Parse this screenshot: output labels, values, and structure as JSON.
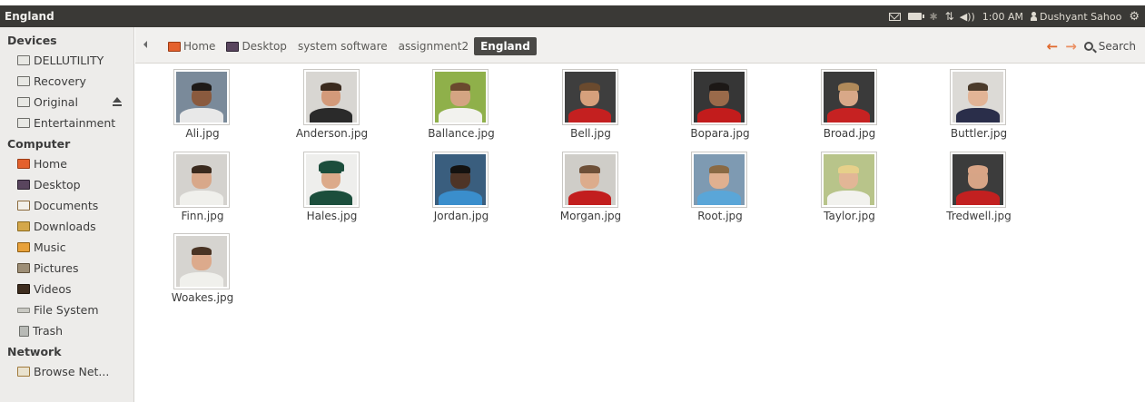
{
  "window": {
    "title": "England"
  },
  "top_panel": {
    "time": "1:00 AM",
    "user": "Dushyant Sahoo"
  },
  "sidebar": {
    "sections": [
      {
        "heading": "Devices",
        "items": [
          {
            "label": "DELLUTILITY",
            "icon": "drive"
          },
          {
            "label": "Recovery",
            "icon": "drive"
          },
          {
            "label": "Original",
            "icon": "drive",
            "eject": true
          },
          {
            "label": "Entertainment",
            "icon": "drive"
          }
        ]
      },
      {
        "heading": "Computer",
        "items": [
          {
            "label": "Home",
            "icon": "home"
          },
          {
            "label": "Desktop",
            "icon": "desktop"
          },
          {
            "label": "Documents",
            "icon": "documents"
          },
          {
            "label": "Downloads",
            "icon": "downloads"
          },
          {
            "label": "Music",
            "icon": "music"
          },
          {
            "label": "Pictures",
            "icon": "pictures"
          },
          {
            "label": "Videos",
            "icon": "videos"
          },
          {
            "label": "File System",
            "icon": "filesystem"
          },
          {
            "label": "Trash",
            "icon": "trash"
          }
        ]
      },
      {
        "heading": "Network",
        "items": [
          {
            "label": "Browse Net...",
            "icon": "network"
          }
        ]
      }
    ]
  },
  "breadcrumbs": [
    {
      "label": "Home",
      "icon": "home"
    },
    {
      "label": "Desktop",
      "icon": "desktop"
    },
    {
      "label": "system software"
    },
    {
      "label": "assignment2"
    },
    {
      "label": "England",
      "active": true
    }
  ],
  "toolbar": {
    "search_label": "Search"
  },
  "files": [
    {
      "name": "Ali.jpg",
      "bg": "#7a8a9a",
      "skin": "#8a5a3e",
      "shirt": "#e8e8e8",
      "hair": "#1e1a18"
    },
    {
      "name": "Anderson.jpg",
      "bg": "#d8d6d2",
      "skin": "#d39a7a",
      "shirt": "#2a2a2a",
      "hair": "#3a2a1e"
    },
    {
      "name": "Ballance.jpg",
      "bg": "#8fb04a",
      "skin": "#d4a482",
      "shirt": "#f2f2ee",
      "hair": "#6a4a2e"
    },
    {
      "name": "Bell.jpg",
      "bg": "#3e3e3e",
      "skin": "#d6a07c",
      "shirt": "#c42020",
      "hair": "#6a4a2e"
    },
    {
      "name": "Bopara.jpg",
      "bg": "#363636",
      "skin": "#9a6a4a",
      "shirt": "#c21c1c",
      "hair": "#1c1816"
    },
    {
      "name": "Broad.jpg",
      "bg": "#3a3a3a",
      "skin": "#d8a888",
      "shirt": "#c62222",
      "hair": "#b08a5a"
    },
    {
      "name": "Buttler.jpg",
      "bg": "#dcdad6",
      "skin": "#e2b496",
      "shirt": "#2a2e4a",
      "hair": "#4a3a2a"
    },
    {
      "name": "Finn.jpg",
      "bg": "#d4d2ce",
      "skin": "#d8a88a",
      "shirt": "#f0f0ec",
      "hair": "#3a2a1e"
    },
    {
      "name": "Hales.jpg",
      "bg": "#eeeeec",
      "skin": "#dcaa8a",
      "shirt": "#1c4e3c",
      "hair": "#1c4e3c",
      "cap": true
    },
    {
      "name": "Jordan.jpg",
      "bg": "#3a5e7e",
      "skin": "#4e3426",
      "shirt": "#3a8ecc",
      "hair": "#141210"
    },
    {
      "name": "Morgan.jpg",
      "bg": "#cfcdc8",
      "skin": "#dcac8c",
      "shirt": "#c21e1e",
      "hair": "#6e5038"
    },
    {
      "name": "Root.jpg",
      "bg": "#7e9ab2",
      "skin": "#e0b090",
      "shirt": "#5aa6d8",
      "hair": "#8a6a44"
    },
    {
      "name": "Taylor.jpg",
      "bg": "#b8c48a",
      "skin": "#e2b696",
      "shirt": "#f2f2ee",
      "hair": "#e6d08a"
    },
    {
      "name": "Tredwell.jpg",
      "bg": "#3c3c3c",
      "skin": "#d6a486",
      "shirt": "#c22020",
      "hair": "#d8a486"
    },
    {
      "name": "Woakes.jpg",
      "bg": "#d6d4d0",
      "skin": "#dcaa8c",
      "shirt": "#f0f0ec",
      "hair": "#4a3424"
    }
  ]
}
